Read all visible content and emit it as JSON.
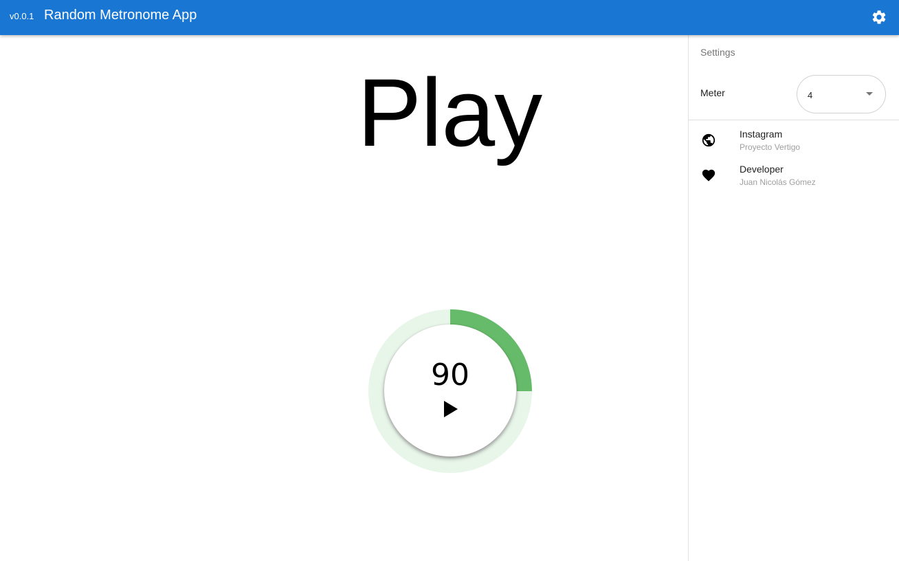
{
  "appbar": {
    "version": "v0.0.1",
    "title": "Random Metronome App",
    "settings_icon": "gear-icon",
    "background_color": "#1976d2"
  },
  "main": {
    "status_text": "Play",
    "tempo": {
      "bpm": "90",
      "play_icon": "play-icon",
      "progress_fraction": 0.25,
      "progress_color": "#66bb6a",
      "track_color": "#e8f5e9"
    }
  },
  "drawer": {
    "header": "Settings",
    "meter": {
      "label": "Meter",
      "value": "4"
    },
    "links": [
      {
        "icon": "globe-icon",
        "title": "Instagram",
        "subtitle": "Proyecto Vertigo"
      },
      {
        "icon": "heart-icon",
        "title": "Developer",
        "subtitle": "Juan Nicolás Gómez"
      }
    ]
  }
}
